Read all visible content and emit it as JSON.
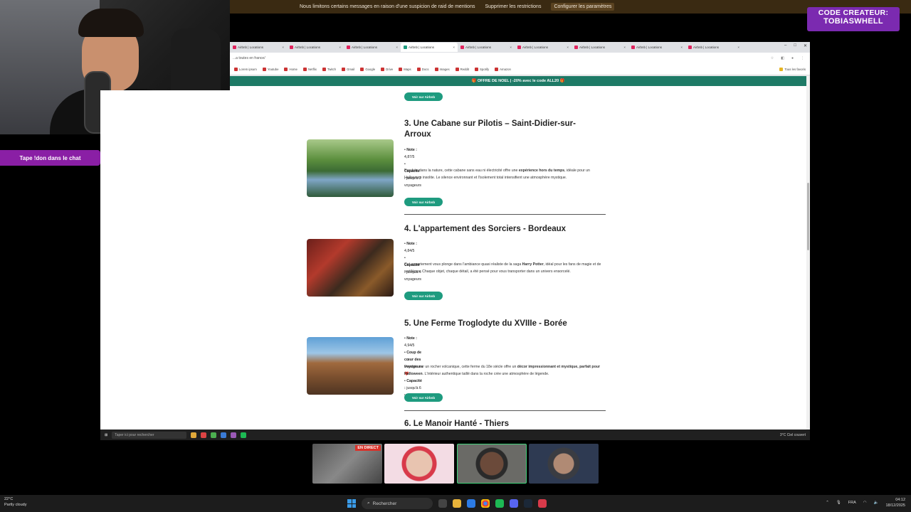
{
  "alert": {
    "message": "Nous limitons certains messages en raison d'une suspicion de raid de mentions",
    "btn1": "Supprimer les restrictions",
    "btn2": "Configurer les paramètres"
  },
  "creator": {
    "line1": "CODE CREATEUR:",
    "line2": "TOBIASWHELL"
  },
  "chat_badge": "Tape !don dans le chat",
  "browser": {
    "tabs": [
      "Airbnb | Locations",
      "Airbnb | Locations",
      "Airbnb | Locations",
      "Airbnb | Locations",
      "Airbnb | Locations",
      "Airbnb | Locations",
      "Airbnb | Locations",
      "Airbnb | Locations",
      "Airbnb | Locations",
      "Airbnb | Locations"
    ],
    "address": "...a toutes en france/",
    "bookmarks": [
      "Lorem ipsum",
      "Youtube",
      "Home",
      "Netflix",
      "Twitch",
      "Gmail",
      "Google",
      "Drive",
      "Maps",
      "Docs",
      "Images",
      "Reddit",
      "Spotify",
      "Amazon",
      "Dossier",
      "Tous les favoris"
    ]
  },
  "promo": "🎁 OFFRE DE NOEL | -20% avec le code ALL20 🎁",
  "entries": [
    {
      "title": "3. Une Cabane sur Pilotis – Saint-Didier-sur-Arroux",
      "bullets": [
        [
          "Note :",
          "4,87/5"
        ],
        [
          "Capacité :",
          "jusqu'à 2 voyageurs"
        ]
      ],
      "desc_a": "Perchée dans la nature, cette cabane sans eau ni électricité offre une ",
      "desc_b": "expérience hors du temps",
      "desc_c": ", idéale pour un Halloween insolite. Le silence environnant et l'isolement total intensifient une atmosphère mystique.",
      "button": "Voir sur Airbnb"
    },
    {
      "title": "4. L'appartement des Sorciers - Bordeaux",
      "bullets": [
        [
          "Note :",
          "4,84/5"
        ],
        [
          "Capacité :",
          "jusqu'à 4 voyageurs"
        ]
      ],
      "desc_a": "Cet appartement vous plonge dans l'ambiance quasi réaliste de la saga ",
      "desc_b": "Harry Potter",
      "desc_c": ", idéal pour les fans de magie et de sortilèges. Chaque objet, chaque détail, a été pensé pour vous transporter dans un univers ensorcelé.",
      "button": "Voir sur Airbnb"
    },
    {
      "title": "5. Une Ferme Troglodyte du XVIIIe - Borée",
      "bullets": [
        [
          "Note :",
          "4,94/5"
        ],
        [
          "Coup de cœur des voyageurs",
          "❤️"
        ],
        [
          "Capacité :",
          "jusqu'à 6 voyageurs"
        ]
      ],
      "desc_a": "Perchée sur un rocher volcanique, cette ferme du 18e siècle offre un ",
      "desc_b": "décor impressionnant et mystique, parfait pour Halloween",
      "desc_c": ". L'intérieur authentique taillé dans la roche crée une atmosphère de légende.",
      "button": "Voir sur Airbnb"
    }
  ],
  "next_title": "6. Le Manoir Hanté - Thiers",
  "top_button": "Voir sur Airbnb",
  "inner_taskbar": {
    "search": "Taper ici pour rechercher",
    "weather": "3°C Ciel couvert"
  },
  "live_badge": "EN DIRECT",
  "os": {
    "weather_temp": "22°C",
    "weather_desc": "Partly cloudy",
    "search": "Rechercher",
    "lang": "FRA",
    "time": "04:12",
    "date": "18/12/2025"
  }
}
